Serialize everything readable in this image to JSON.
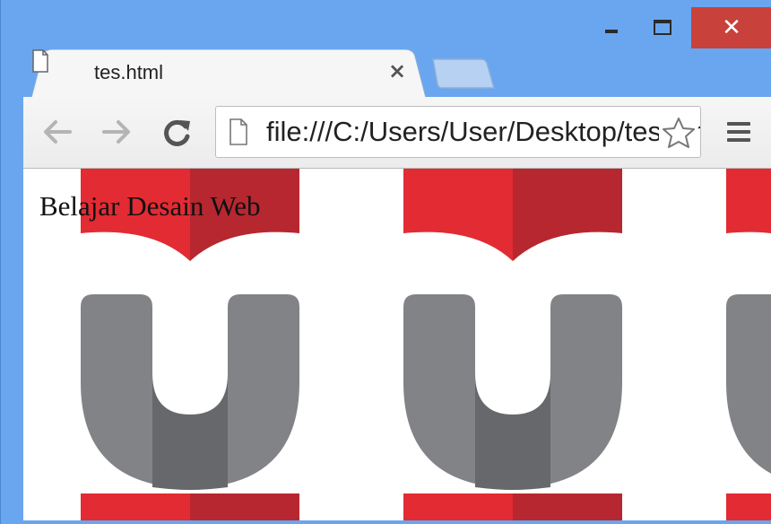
{
  "window": {
    "controls": {
      "minimize": "minimize",
      "maximize": "maximize",
      "close": "✕"
    }
  },
  "tab": {
    "title": "tes.html",
    "close_glyph": "×",
    "icon": "page-icon"
  },
  "toolbar": {
    "back_icon": "arrow-left-icon",
    "forward_icon": "arrow-right-icon",
    "reload_icon": "reload-icon",
    "menu_icon": "hamburger-icon"
  },
  "address_bar": {
    "url": "file:///C:/Users/User/Desktop/tes.html",
    "icon": "page-icon",
    "bookmark_icon": "star-icon"
  },
  "page": {
    "text": "Belajar Desain Web",
    "background_logo": "university-logo-tile"
  },
  "colors": {
    "frame": "#6aa6ef",
    "close_button": "#c9413b",
    "logo_red": "#e22b33",
    "logo_red_dark": "#b72730",
    "logo_grey": "#828386",
    "logo_grey_dark": "#67686b"
  }
}
